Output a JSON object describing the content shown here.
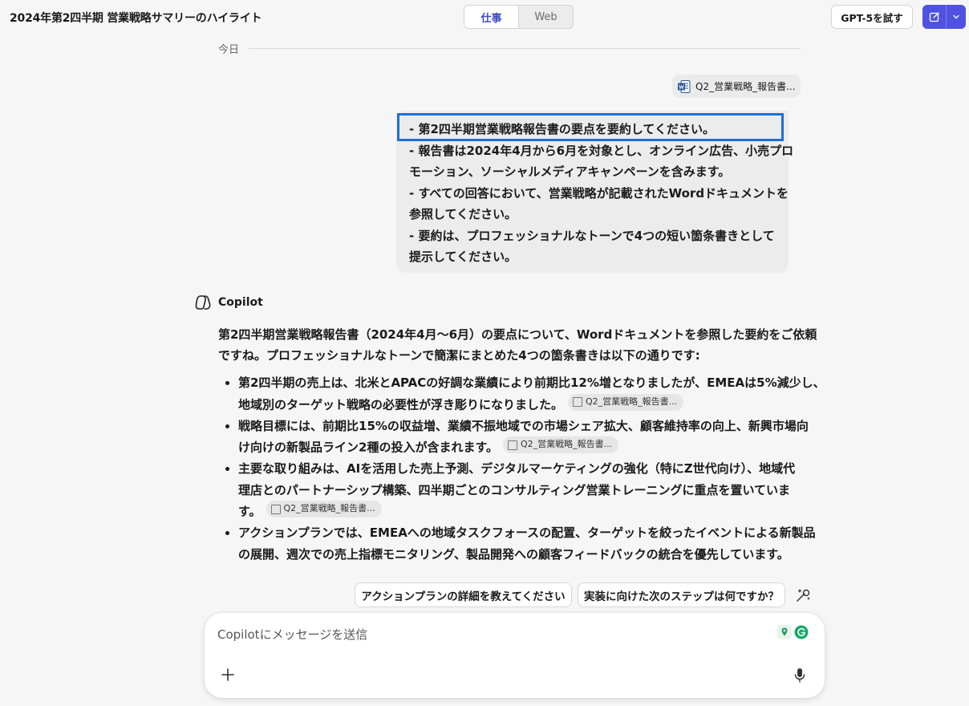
{
  "header": {
    "title": "2024年第2四半期 営業戦略サマリーのハイライト",
    "mode_tabs": [
      {
        "label": "仕事",
        "active": true
      },
      {
        "label": "Web",
        "active": false
      }
    ],
    "try_gpt_label": "GPT-5を試す",
    "accent_color": "#4f52e0"
  },
  "conversation": {
    "date_label": "今日",
    "attachment": {
      "name": "Q2_営業戦略_報告書...",
      "icon": "word-document-icon"
    },
    "user_message": {
      "lines": [
        "- 第2四半期営業戦略報告書の要点を要約してください。",
        "- 報告書は2024年4月から6月を対象とし、オンライン広告、小売プロ",
        "モーション、ソーシャルメディアキャンペーンを含みます。",
        "- すべての回答において、営業戦略が記載されたWordドキュメントを",
        "参照してください。",
        "- 要約は、プロフェッショナルなトーンで4つの短い箇条書きとして",
        "提示してください。"
      ]
    },
    "assistant": {
      "name": "Copilot",
      "intro_lines": [
        "第2四半期営業戦略報告書（2024年4月〜6月）の要点について、Wordドキュメントを参照した要約をご依頼",
        "ですね。プロフェッショナルなトーンで簡潔にまとめた4つの箇条書きは以下の通りです:"
      ],
      "bullets": [
        {
          "lines": [
            "第2四半期の売上は、北米とAPACの好調な業績により前期比12%増となりましたが、EMEAは5%減少し、",
            "地域別のターゲット戦略の必要性が浮き彫りになりました。"
          ],
          "citation": "Q2_営業戦略_報告書..."
        },
        {
          "lines": [
            "戦略目標には、前期比15%の収益増、業績不振地域での市場シェア拡大、顧客維持率の向上、新興市場向",
            "け向けの新製品ライン2種の投入が含まれます。"
          ],
          "citation": "Q2_営業戦略_報告書..."
        },
        {
          "lines": [
            "主要な取り組みは、AIを活用した売上予測、デジタルマーケティングの強化（特にZ世代向け）、地域代",
            "理店とのパートナーシップ構築、四半期ごとのコンサルティング営業トレーニングに重点を置いていま",
            "す。"
          ],
          "citation": "Q2_営業戦略_報告書..."
        },
        {
          "lines": [
            "アクションプランでは、EMEAへの地域タスクフォースの配置、ターゲットを絞ったイベントによる新製品",
            "の展開、週次での売上指標モニタリング、製品開発への顧客フィードバックの統合を優先しています。"
          ],
          "citation": ""
        }
      ]
    }
  },
  "suggestions": [
    "アクションプランの詳細を教えてください",
    "実装に向けた次のステップは何ですか？"
  ],
  "composer": {
    "placeholder": "Copilotにメッセージを送信"
  }
}
